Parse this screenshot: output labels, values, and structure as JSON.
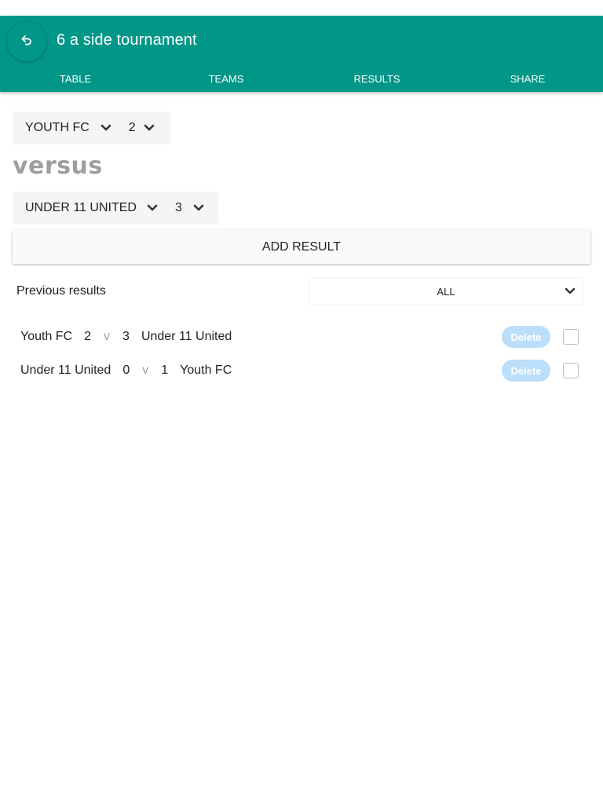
{
  "header": {
    "title": "6 a side tournament",
    "tabs": [
      {
        "label": "Table"
      },
      {
        "label": "Teams"
      },
      {
        "label": "Results"
      },
      {
        "label": "Share"
      }
    ]
  },
  "match_form": {
    "home_team": "YOUTH FC",
    "home_score": "2",
    "versus_label": "versus",
    "away_team": "UNDER 11 UNITED",
    "away_score": "3",
    "add_button_label": "Add result"
  },
  "previous_results": {
    "label": "Previous results",
    "filter_value": "All",
    "delete_label": "Delete",
    "vs_label": "v",
    "rows": [
      {
        "team1": "Youth FC",
        "score1": "2",
        "score2": "3",
        "team2": "Under 11 United"
      },
      {
        "team1": "Under 11 United",
        "score1": "0",
        "score2": "1",
        "team2": "Youth FC"
      }
    ]
  },
  "icons": {
    "back": "undo-arrow-icon",
    "dropdown": "chevron-down-icon"
  },
  "colors": {
    "primary": "#009688",
    "delete_button": "#bbdefb",
    "versus_text": "#9e9e9e"
  }
}
